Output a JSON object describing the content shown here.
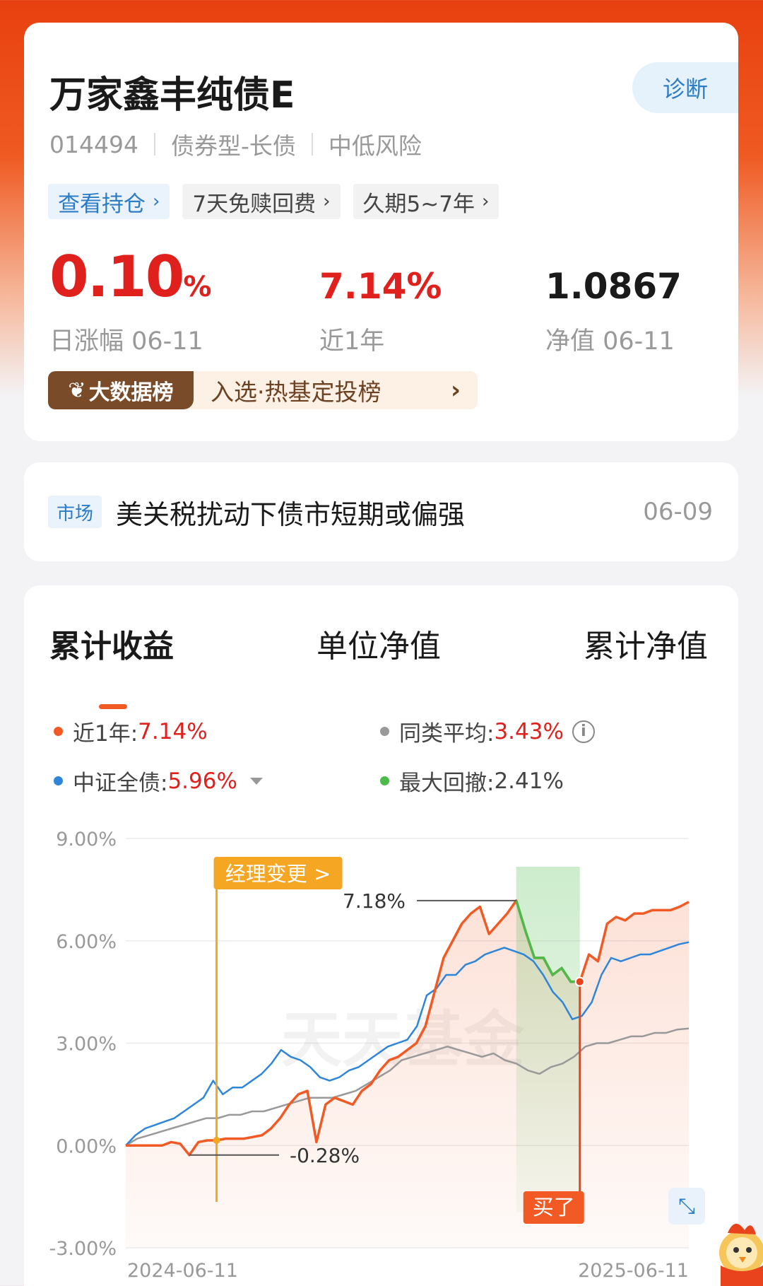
{
  "fund": {
    "name": "万家鑫丰纯债E",
    "diagnose_label": "诊断",
    "code": "014494",
    "type": "债券型-长债",
    "risk": "中低风险",
    "chips": [
      {
        "label": "查看持仓",
        "icon": "chevron-right"
      },
      {
        "label": "7天免赎回费",
        "icon": "chevron-right"
      },
      {
        "label": "久期5~7年",
        "icon": "chevron-right"
      }
    ],
    "daily_change": "0.10",
    "daily_change_unit": "%",
    "daily_change_label": "日涨幅 06-11",
    "year_return": "7.14%",
    "year_return_label": "近1年",
    "nav": "1.0867",
    "nav_label": "净值 06-11",
    "rank_tag": "大数据榜",
    "rank_text": "入选·热基定投榜",
    "rank_arrow": "›"
  },
  "news": {
    "tag": "市场",
    "title": "美关税扰动下债市短期或偏强",
    "date": "06-09"
  },
  "chart_tabs": [
    "累计收益",
    "单位净值",
    "累计净值"
  ],
  "active_tab": 0,
  "legend": [
    {
      "label": "近1年:",
      "value": "7.14%",
      "color": "#f15a24"
    },
    {
      "label": "同类平均:",
      "value": "3.43%",
      "color": "#999999"
    },
    {
      "label": "中证全债:",
      "value": "5.96%",
      "color": "#2f86d8"
    },
    {
      "label": "最大回撤:",
      "value": "2.41%",
      "color": "#4cbb4c"
    }
  ],
  "chart_data": {
    "type": "line",
    "x_start": "2024-06-11",
    "x_end": "2025-06-11",
    "y_ticks": [
      "9.00%",
      "6.00%",
      "3.00%",
      "0.00%",
      "-3.00%"
    ],
    "ylim": [
      -3,
      9
    ],
    "series": [
      {
        "name": "近1年",
        "color": "#f15a24",
        "values": [
          0,
          0,
          0,
          0,
          0,
          0.1,
          0.05,
          -0.28,
          0.1,
          0.15,
          0.15,
          0.2,
          0.2,
          0.2,
          0.25,
          0.3,
          0.5,
          0.8,
          1.2,
          1.5,
          1.6,
          0.1,
          1.2,
          1.4,
          1.3,
          1.2,
          1.6,
          1.8,
          2.2,
          2.5,
          2.6,
          2.8,
          3.0,
          3.5,
          4.5,
          5.5,
          6.0,
          6.5,
          6.8,
          7.0,
          6.2,
          6.5,
          6.8,
          7.18,
          6.3,
          5.5,
          5.5,
          5.0,
          5.2,
          4.8,
          4.8,
          5.6,
          5.4,
          6.5,
          6.7,
          6.6,
          6.8,
          6.8,
          6.9,
          6.9,
          6.9,
          7.0,
          7.14
        ]
      },
      {
        "name": "中证全债",
        "color": "#2f86d8",
        "values": [
          0,
          0.3,
          0.5,
          0.6,
          0.7,
          0.8,
          1.0,
          1.2,
          1.4,
          1.9,
          1.5,
          1.7,
          1.7,
          1.9,
          2.1,
          2.4,
          2.8,
          2.6,
          2.5,
          2.3,
          2.0,
          1.9,
          2.0,
          2.2,
          2.3,
          2.5,
          2.7,
          2.9,
          3.0,
          3.1,
          3.5,
          4.4,
          4.6,
          5.0,
          5.0,
          5.3,
          5.4,
          5.6,
          5.7,
          5.8,
          5.7,
          5.6,
          5.4,
          5.0,
          4.5,
          4.2,
          3.7,
          3.8,
          4.2,
          5.0,
          5.5,
          5.4,
          5.5,
          5.6,
          5.6,
          5.7,
          5.8,
          5.9,
          5.96
        ]
      },
      {
        "name": "同类平均",
        "color": "#999999",
        "values": [
          0,
          0.2,
          0.3,
          0.4,
          0.5,
          0.6,
          0.7,
          0.8,
          0.8,
          0.9,
          0.9,
          1.0,
          1.0,
          1.1,
          1.2,
          1.3,
          1.4,
          1.4,
          1.4,
          1.5,
          1.6,
          1.8,
          2.0,
          2.2,
          2.5,
          2.6,
          2.7,
          2.8,
          2.9,
          2.8,
          2.7,
          2.6,
          2.7,
          2.5,
          2.4,
          2.2,
          2.1,
          2.3,
          2.4,
          2.6,
          2.9,
          3.0,
          3.0,
          3.1,
          3.2,
          3.2,
          3.3,
          3.3,
          3.4,
          3.43
        ]
      }
    ],
    "annotations": {
      "manager_change": "经理变更 >",
      "max_value_label": "7.18%",
      "min_value_label": "-0.28%",
      "bought_label": "买了",
      "watermark": "天天基金"
    }
  }
}
